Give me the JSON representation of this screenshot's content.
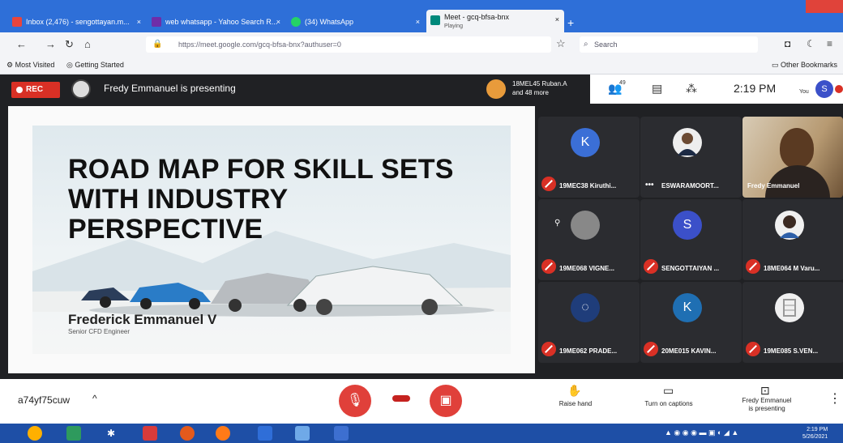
{
  "browser": {
    "tabs": [
      {
        "label": "Inbox (2,476) - sengottayan.m...",
        "icon_color": "#e8453c"
      },
      {
        "label": "web whatsapp - Yahoo Search R...",
        "icon_color": "#6f2da8"
      },
      {
        "label": "(34) WhatsApp",
        "icon_color": "#25d366"
      },
      {
        "label": "Meet - gcq-bfsa-bnx",
        "sublabel": "Playing",
        "icon_color": "#00897b",
        "active": true
      }
    ],
    "url": "https://meet.google.com/gcq-bfsa-bnx?authuser=0",
    "search_placeholder": "Search",
    "bookmarks": [
      "Most Visited",
      "Getting Started"
    ],
    "other_bookmarks": "Other Bookmarks"
  },
  "meet": {
    "rec_label": "REC",
    "presenting_text": "Fredy Emmanuel is presenting",
    "others_text_line1": "18MEL45 Ruban.A",
    "others_text_line2": "and 48 more",
    "participants_count": "49",
    "clock": "2:19 PM",
    "you_label": "You",
    "you_initial": "S",
    "slide": {
      "title_lines": [
        "ROAD MAP FOR SKILL SETS",
        "WITH INDUSTRY",
        "PERSPECTIVE"
      ],
      "name": "Frederick Emmanuel V",
      "role": "Senior CFD Engineer"
    },
    "tiles": [
      {
        "initial": "K",
        "name": "19MEC38 Kiruthi...",
        "color": "#3b6fd6"
      },
      {
        "initial": "",
        "name": "ESWARAMOORT...",
        "color": "#eeeeee"
      },
      {
        "initial": "",
        "name": "Fredy Emmanuel",
        "color": ""
      },
      {
        "initial": "",
        "name": "19ME068 VIGNE...",
        "color": "#888888"
      },
      {
        "initial": "S",
        "name": "SENGOTTAIYAN ...",
        "color": "#3b50c9"
      },
      {
        "initial": "",
        "name": "18ME064 M Varu...",
        "color": "#f0f0f0"
      },
      {
        "initial": "",
        "name": "19ME062 PRADE...",
        "color": "#1f3d7a"
      },
      {
        "initial": "K",
        "name": "20ME015 KAVIN...",
        "color": "#1f6fb3"
      },
      {
        "initial": "",
        "name": "19ME085 S.VEN...",
        "color": "#f0f0f0"
      }
    ],
    "meeting_code": "a74yf75cuw",
    "controls": {
      "raise_hand": "Raise hand",
      "captions": "Turn on captions",
      "presenting_line1": "Fredy Emmanuel",
      "presenting_line2": "is presenting"
    }
  },
  "taskbar": {
    "time": "2:19 PM",
    "date": "5/26/2021"
  }
}
